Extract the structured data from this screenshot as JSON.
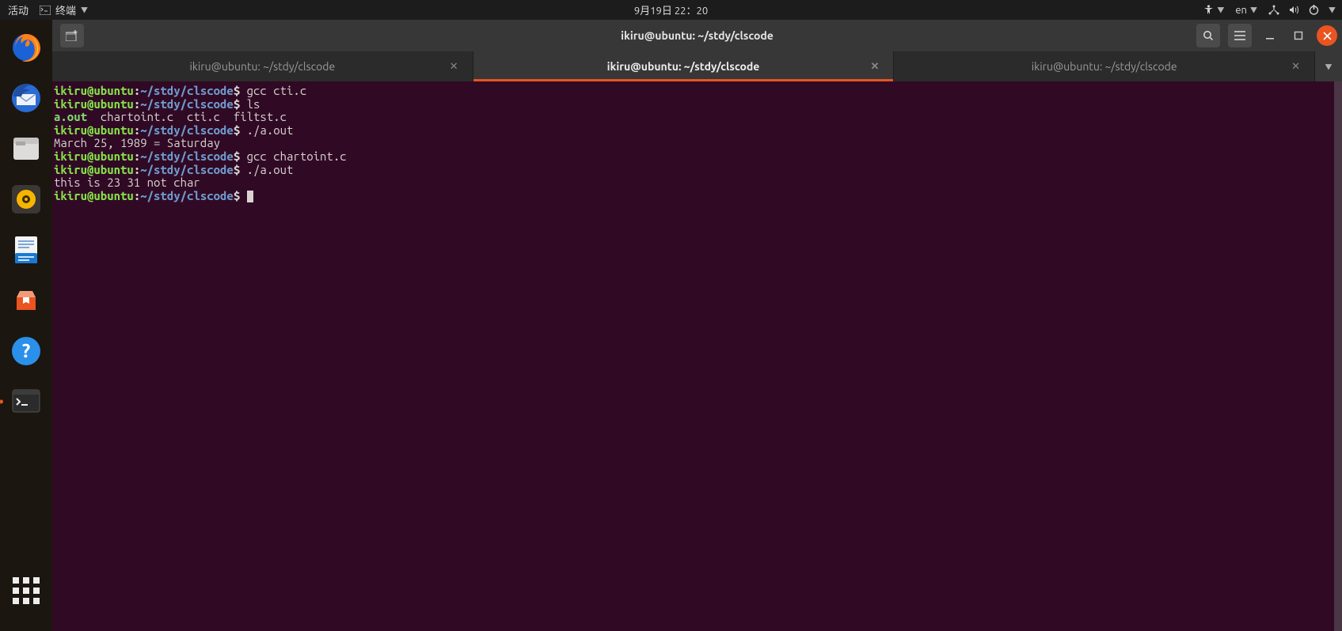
{
  "topbar": {
    "activities": "活动",
    "app_indicator": "终端",
    "datetime": "9月19日 22：20",
    "lang": "en"
  },
  "dock": {
    "items": [
      "firefox",
      "thunderbird",
      "files",
      "rhythmbox",
      "writer",
      "software",
      "help",
      "terminal"
    ],
    "active": "terminal"
  },
  "window": {
    "title": "ikiru@ubuntu: ~/stdy/clscode"
  },
  "tabs": {
    "items": [
      {
        "label": "ikiru@ubuntu: ~/stdy/clscode",
        "active": false
      },
      {
        "label": "ikiru@ubuntu: ~/stdy/clscode",
        "active": true
      },
      {
        "label": "ikiru@ubuntu: ~/stdy/clscode",
        "active": false
      }
    ]
  },
  "prompt": {
    "user_host": "ikiru@ubuntu",
    "path": "~/stdy/clscode",
    "symbol": "$"
  },
  "terminal": {
    "lines": [
      {
        "type": "cmd",
        "text": "gcc cti.c"
      },
      {
        "type": "cmd",
        "text": "ls"
      },
      {
        "type": "ls",
        "exec": "a.out",
        "rest": "  chartoint.c  cti.c  filtst.c"
      },
      {
        "type": "cmd",
        "text": "./a.out"
      },
      {
        "type": "out",
        "text": "March 25, 1989 = Saturday"
      },
      {
        "type": "cmd",
        "text": "gcc chartoint.c"
      },
      {
        "type": "cmd",
        "text": "./a.out"
      },
      {
        "type": "out",
        "text": "this is 23 31 not char"
      },
      {
        "type": "cmd",
        "text": "",
        "cursor": true
      }
    ]
  }
}
